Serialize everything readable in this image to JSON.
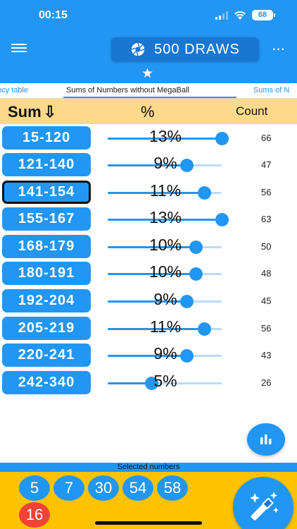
{
  "status": {
    "time": "00:15",
    "battery": "68"
  },
  "header": {
    "draws_label": "500 DRAWS",
    "more_label": "···",
    "star": "★"
  },
  "tabs": [
    {
      "label": "ncy table"
    },
    {
      "label": "Sums of Numbers without MegaBall"
    },
    {
      "label": "Sums of N"
    }
  ],
  "table": {
    "col_sum": "Sum",
    "col_sum_arrow": "⇩",
    "col_pct": "%",
    "col_count": "Count",
    "rows": [
      {
        "range": "15-120",
        "pct": "13%",
        "pct_value": 13,
        "count": "66"
      },
      {
        "range": "121-140",
        "pct": "9%",
        "pct_value": 9,
        "count": "47"
      },
      {
        "range": "141-154",
        "pct": "11%",
        "pct_value": 11,
        "count": "56",
        "selected": true
      },
      {
        "range": "155-167",
        "pct": "13%",
        "pct_value": 13,
        "count": "63"
      },
      {
        "range": "168-179",
        "pct": "10%",
        "pct_value": 10,
        "count": "50"
      },
      {
        "range": "180-191",
        "pct": "10%",
        "pct_value": 10,
        "count": "48"
      },
      {
        "range": "192-204",
        "pct": "9%",
        "pct_value": 9,
        "count": "45"
      },
      {
        "range": "205-219",
        "pct": "11%",
        "pct_value": 11,
        "count": "56"
      },
      {
        "range": "220-241",
        "pct": "9%",
        "pct_value": 9,
        "count": "43"
      },
      {
        "range": "242-340",
        "pct": "5%",
        "pct_value": 5,
        "count": "26"
      }
    ],
    "slider_max_pct": 13
  },
  "selected": {
    "label": "Selected numbers",
    "numbers": [
      "5",
      "7",
      "30",
      "54",
      "58"
    ],
    "megaball": "16"
  },
  "colors": {
    "primary": "#2196F3",
    "header_row": "#FDD98B",
    "bottom_panel": "#FDC300",
    "megaball": "#F44336"
  }
}
